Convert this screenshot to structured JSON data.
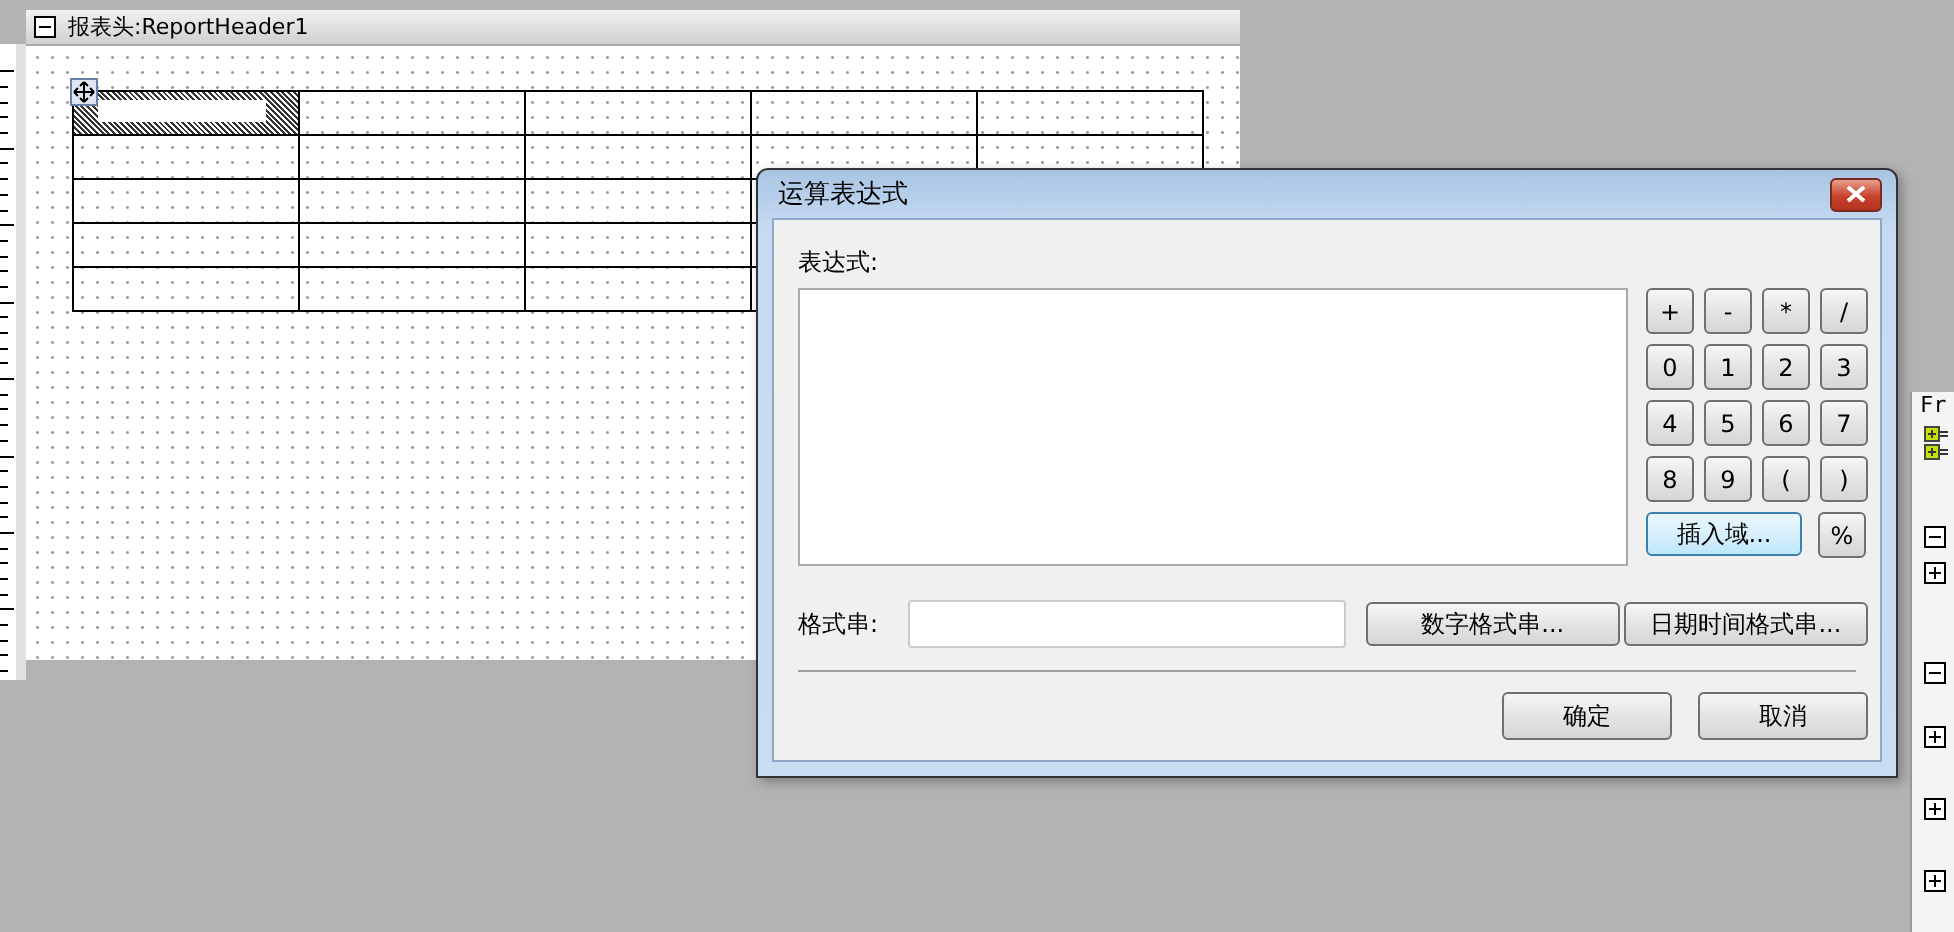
{
  "band": {
    "title": "报表头:ReportHeader1",
    "expanded": true
  },
  "table": {
    "rows": [
      {
        "cells": [
          {
            "selected": true
          },
          {
            "selected": false
          },
          {
            "selected": false
          },
          {
            "selected": false
          },
          {
            "selected": false
          }
        ]
      },
      {
        "cells": [
          {
            "selected": false
          },
          {
            "selected": false
          },
          {
            "selected": false
          },
          {
            "selected": false
          },
          {
            "selected": false
          }
        ]
      },
      {
        "cells": [
          {
            "selected": false
          },
          {
            "selected": false
          },
          {
            "selected": false
          },
          {
            "selected": false
          }
        ]
      },
      {
        "cells": [
          {
            "selected": false
          },
          {
            "selected": false
          },
          {
            "selected": false
          },
          {
            "selected": false
          }
        ]
      },
      {
        "cells": [
          {
            "selected": false
          },
          {
            "selected": false
          },
          {
            "selected": false
          },
          {
            "selected": false
          }
        ]
      }
    ]
  },
  "side_panel": {
    "header": "Fr",
    "nodes": [
      {
        "expanded": true
      },
      {
        "expanded": false
      },
      {
        "expanded": true
      },
      {
        "expanded": false
      },
      {
        "expanded": false
      },
      {
        "expanded": false
      }
    ]
  },
  "dialog": {
    "title": "运算表达式",
    "expression_label": "表达式:",
    "keys": [
      "+",
      "-",
      "*",
      "/",
      "0",
      "1",
      "2",
      "3",
      "4",
      "5",
      "6",
      "7",
      "8",
      "9",
      "(",
      ")"
    ],
    "insert_field_button": "插入域...",
    "percent_button": "%",
    "format_label": "格式串:",
    "number_format_button": "数字格式串...",
    "datetime_format_button": "日期时间格式串...",
    "ok_button": "确定",
    "cancel_button": "取消"
  }
}
